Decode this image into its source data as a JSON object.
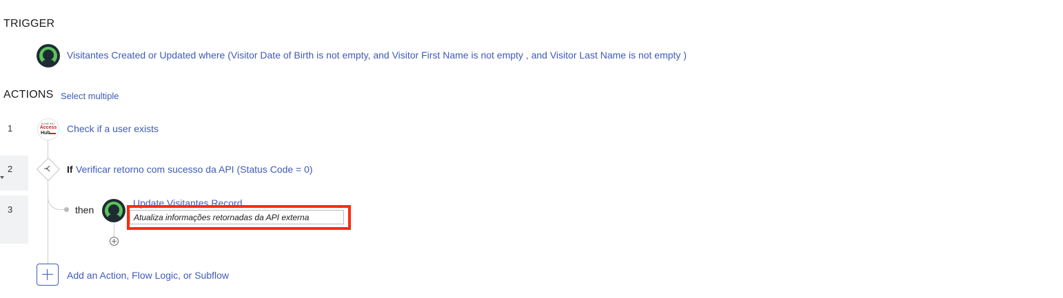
{
  "trigger": {
    "heading": "TRIGGER",
    "icon": "visitantes-app-icon",
    "description": "Visitantes Created or Updated where (Visitor Date of Birth is not empty, and Visitor First Name is not empty , and Visitor Last Name is not empty )"
  },
  "actions": {
    "heading": "ACTIONS",
    "select_multiple": "Select multiple",
    "steps": [
      {
        "number": "1",
        "label": "Check if a user exists",
        "icon": "access-hub-icon"
      },
      {
        "number": "2",
        "keyword": "If",
        "label": "Verificar retorno com sucesso da API (Status Code = 0)",
        "icon": "flow-logic-icon"
      },
      {
        "number": "3",
        "prefix": "then",
        "label": "Update Visitantes Record",
        "annotation": "Atualiza informações retornadas da API externa",
        "icon": "visitantes-app-icon"
      }
    ],
    "add_label": "Add an Action, Flow Logic, or Subflow"
  },
  "access_hub_logo": {
    "line1": "ACME INC.",
    "line2": "Access",
    "line3": "Hub"
  },
  "colors": {
    "link": "#3f5ab8",
    "highlight": "#ff2a0d",
    "icon_green": "#5ac45a",
    "icon_dark": "#1f2b33"
  }
}
